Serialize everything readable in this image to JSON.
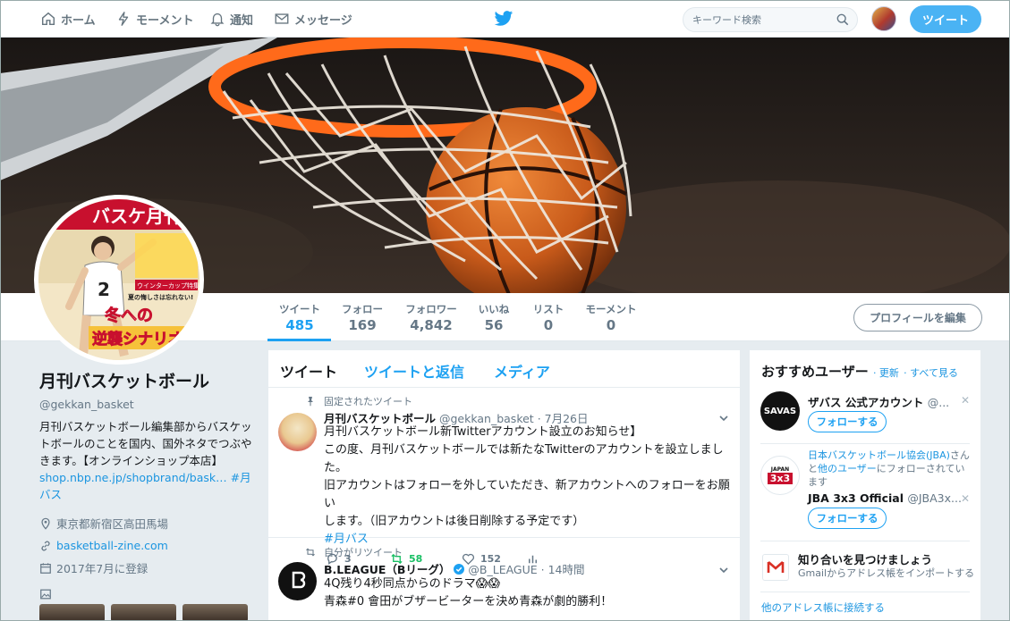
{
  "nav": {
    "home": "ホーム",
    "moments": "モーメント",
    "notifications": "通知",
    "messages": "メッセージ",
    "search_placeholder": "キーワード検索",
    "tweet_button": "ツイート"
  },
  "profile_nav": {
    "stats": [
      {
        "label": "ツイート",
        "value": "485"
      },
      {
        "label": "フォロー",
        "value": "169"
      },
      {
        "label": "フォロワー",
        "value": "4,842"
      },
      {
        "label": "いいね",
        "value": "56"
      },
      {
        "label": "リスト",
        "value": "0"
      },
      {
        "label": "モーメント",
        "value": "0"
      }
    ],
    "edit_button": "プロフィールを編集"
  },
  "avatar_cover": {
    "title": "バスケ月刊",
    "headline1": "冬への",
    "headline2": "逆襲シナリオ",
    "tagline": "ウインターカップ特集",
    "sub": "夏の悔しさは忘れない!"
  },
  "profile": {
    "name": "月刊バスケットボール",
    "handle": "@gekkan_basket",
    "bio": "月刊バスケットボール編集部からバスケットボールのことを国内、国外ネタでつぶやきます。【オンラインショップ本店】",
    "bio_link": "shop.nbp.ne.jp/shopbrand/bask…",
    "bio_hashtag": "#月バス",
    "location": "東京都新宿区高田馬場",
    "website": "basketball-zine.com",
    "joined": "2017年7月に登録"
  },
  "timeline": {
    "tabs": [
      "ツイート",
      "ツイートと返信",
      "メディア"
    ],
    "tweets": [
      {
        "context": "固定されたツイート",
        "name": "月刊バスケットボール",
        "handle": "@gekkan_basket",
        "date": "· 7月26日",
        "lines": [
          "月刊バスケットボール新Twitterアカウント設立のお知らせ】",
          "この度、月刊バスケットボールでは新たなTwitterのアカウントを設立しました。",
          "旧アカウントはフォローを外していただき、新アカウントへのフォローをお願い",
          "します。（旧アカウントは後日削除する予定です）"
        ],
        "hashtag": "#月バス",
        "replies": "3",
        "retweets": "58",
        "likes": "152"
      },
      {
        "context": "自分がリツイート",
        "name": "B.LEAGUE（Bリーグ）",
        "handle": "@B_LEAGUE",
        "date": "· 14時間",
        "line1": "4Q残り4秒同点からのドラマ",
        "emoji": "😱😱",
        "line2": "青森#0 會田がブザービーターを決め青森が劇的勝利！",
        "avatar_text": "B.LEAGUE"
      }
    ]
  },
  "recommend": {
    "title": "おすすめユーザー",
    "refresh": "· 更新",
    "see_all": "· すべて見る",
    "follow_label": "フォローする",
    "users": [
      {
        "name": "ザバス 公式アカウント",
        "handle": "@...",
        "logo": "SAVAS"
      },
      {
        "context_link": "日本バスケットボール協会(JBA)",
        "context_text1": "さん",
        "context_text2": "と",
        "context_link2": "他のユーザー",
        "context_text3": "にフォローされています",
        "name": "JBA 3x3 Official",
        "handle": "@JBA3x...",
        "logo": "3x3",
        "logo_top": "JAPAN"
      }
    ],
    "find": {
      "title": "知り合いを見つけましょう",
      "sub": "Gmailからアドレス帳をインポートする",
      "link": "他のアドレス帳に接続する"
    },
    "colors": {
      "accent": "#1da1f2",
      "button": "#4ab3f4"
    }
  }
}
